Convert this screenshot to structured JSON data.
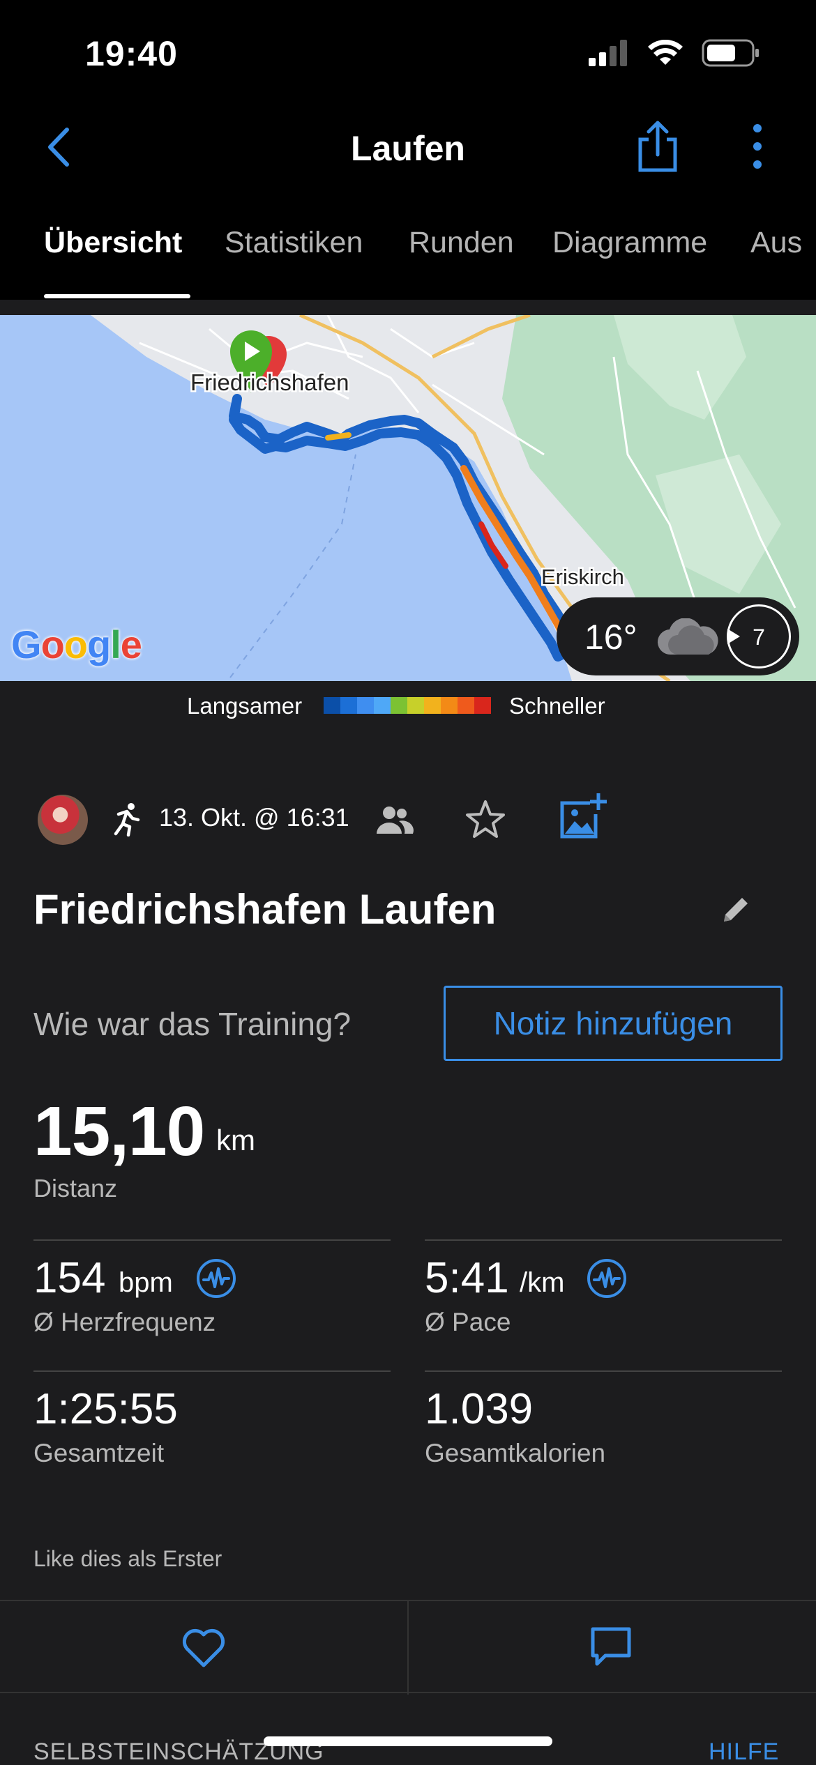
{
  "status_bar": {
    "time": "19:40"
  },
  "nav": {
    "title": "Laufen"
  },
  "tabs": [
    {
      "label": "Übersicht"
    },
    {
      "label": "Statistiken"
    },
    {
      "label": "Runden"
    },
    {
      "label": "Diagramme"
    },
    {
      "label": "Aus"
    }
  ],
  "map": {
    "labels": {
      "city_start": "Friedrichshafen",
      "city_end": "Eriskirch"
    },
    "provider": "Google",
    "weather": {
      "temp": "16°",
      "wind": "7"
    }
  },
  "legend": {
    "slow_label": "Langsamer",
    "fast_label": "Schneller",
    "colors": [
      "#0b4fa8",
      "#1c6fd6",
      "#3f8ef0",
      "#4fa8f7",
      "#7cc233",
      "#c7d02a",
      "#f2b21d",
      "#f38a16",
      "#ef5a1c",
      "#d9261c"
    ]
  },
  "activity": {
    "date": "13. Okt. @ 16:31",
    "title": "Friedrichshafen Laufen",
    "prompt": "Wie war das Training?",
    "note_button": "Notiz hinzufügen"
  },
  "stats": {
    "distance": {
      "value": "15,10",
      "unit": "km",
      "label": "Distanz"
    },
    "heart_rate": {
      "value": "154",
      "unit": "bpm",
      "label": "Ø Herzfrequenz"
    },
    "pace": {
      "value": "5:41",
      "unit": "/km",
      "label": "Ø Pace"
    },
    "total_time": {
      "value": "1:25:55",
      "label": "Gesamtzeit"
    },
    "calories": {
      "value": "1.039",
      "label": "Gesamtkalorien"
    }
  },
  "social": {
    "like_text": "Like dies als Erster"
  },
  "footer": {
    "section_label": "SELBSTEINSCHÄTZUNG",
    "help_label": "HILFE"
  },
  "theme": {
    "accent": "#3a8ee6",
    "background": "#1c1c1e",
    "bar_background": "#000000"
  }
}
